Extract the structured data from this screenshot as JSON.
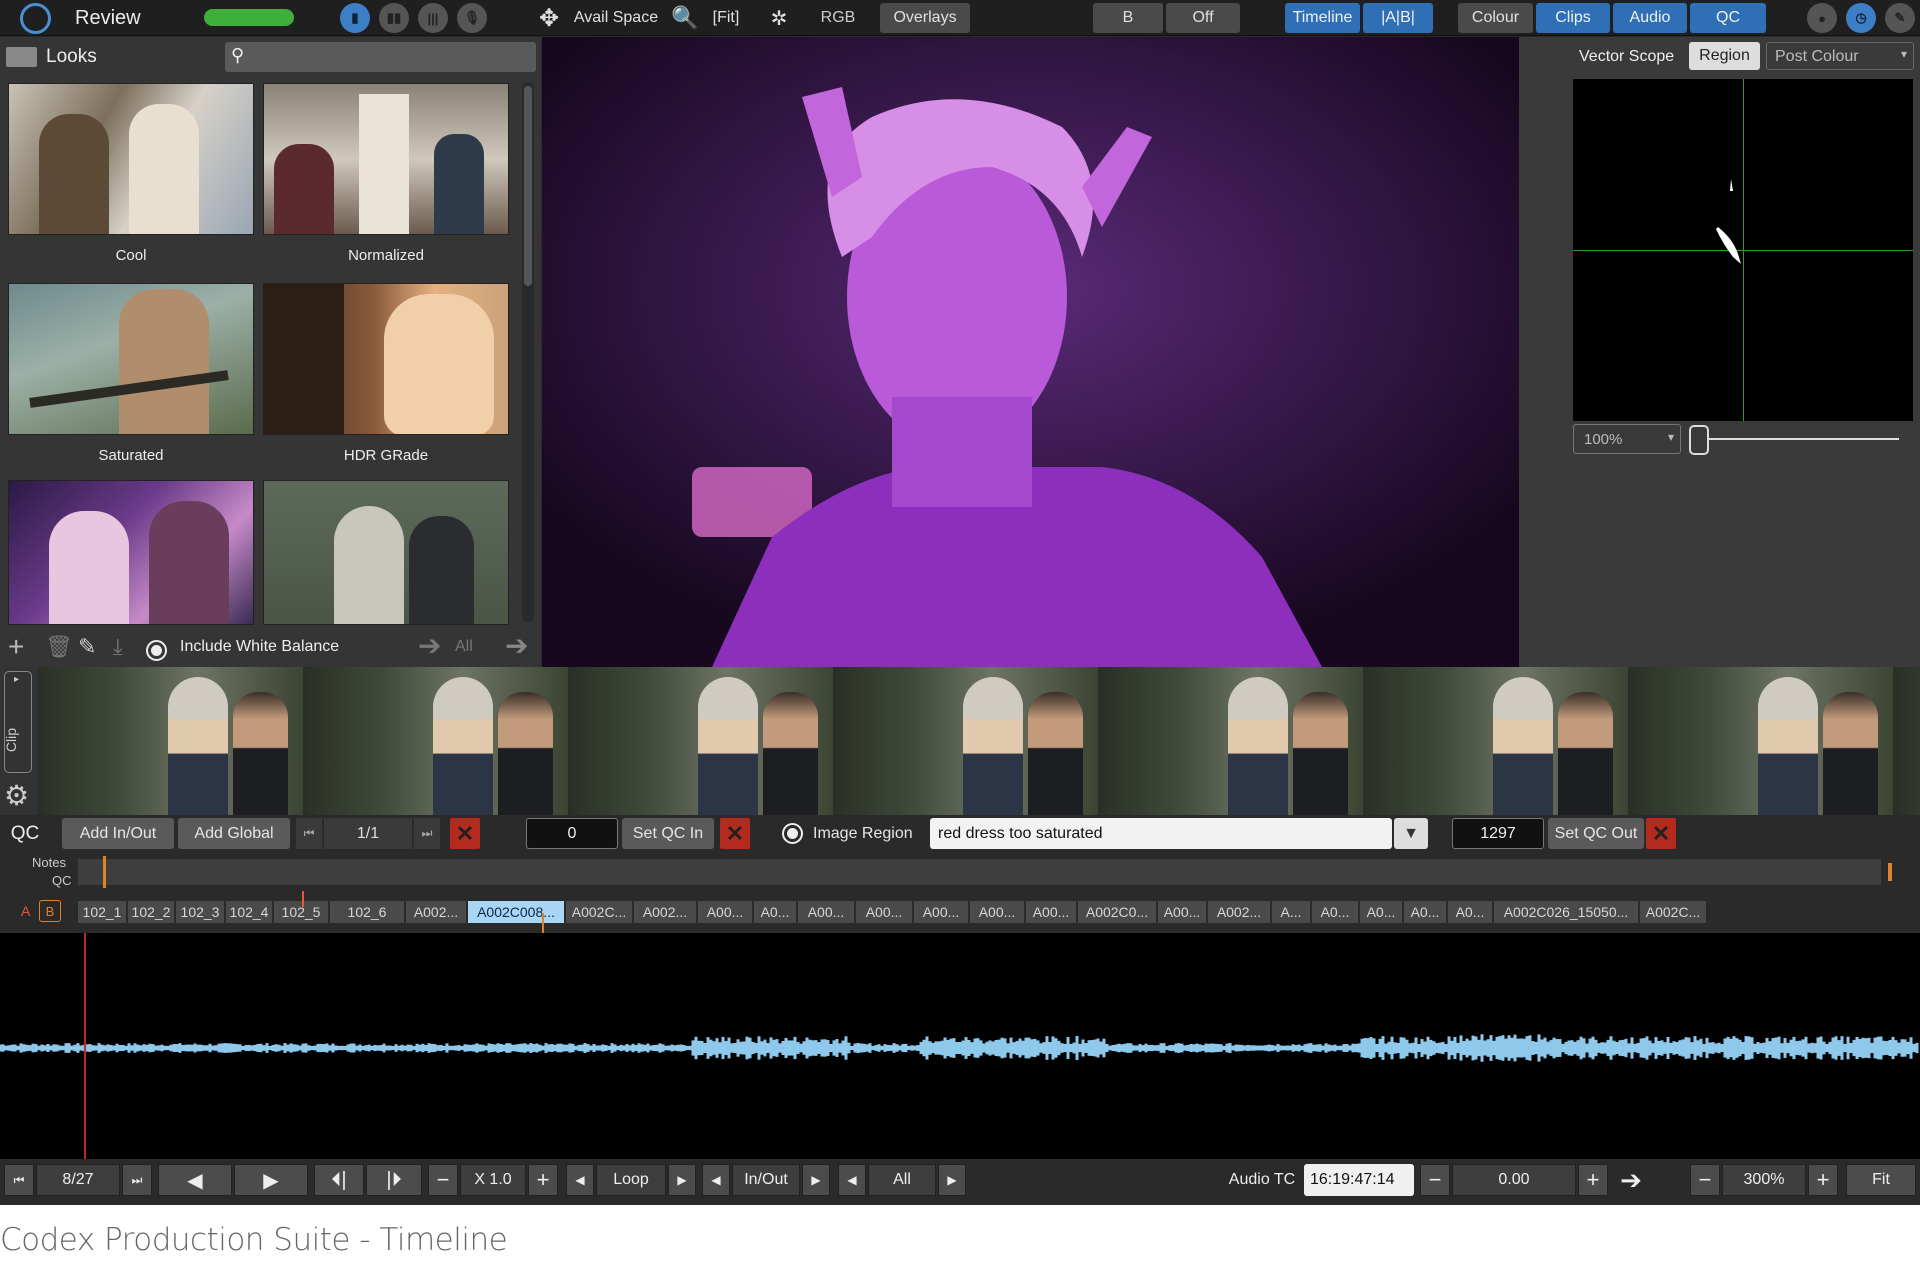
{
  "app": {
    "title": "Review",
    "caption": "Codex Production Suite  - Timeline"
  },
  "toolbar": {
    "avail_space": "Avail Space",
    "fit": "[Fit]",
    "rgb": "RGB",
    "overlays": "Overlays",
    "b": "B",
    "off": "Off",
    "timeline": "Timeline",
    "ab": "|A|B|",
    "colour": "Colour",
    "clips": "Clips",
    "audio": "Audio",
    "qc": "QC"
  },
  "looks": {
    "title": "Looks",
    "items": [
      {
        "label": "Cool"
      },
      {
        "label": "Normalized"
      },
      {
        "label": "Saturated"
      },
      {
        "label": "HDR GRade"
      },
      {
        "label": ""
      },
      {
        "label": ""
      }
    ],
    "include_white_balance": "Include White Balance",
    "all": "All"
  },
  "scope": {
    "title": "Vector Scope",
    "region": "Region",
    "mode": "Post Colour",
    "zoom": "100%",
    "slider_value": 0
  },
  "clipstrip": {
    "label": "Clip"
  },
  "qc": {
    "label": "QC",
    "add_in_out": "Add In/Out",
    "add_global": "Add Global",
    "page": "1/1",
    "in_value": "0",
    "set_qc_in": "Set QC In",
    "image_region": "Image Region",
    "note_text": "red dress too saturated",
    "out_value": "1297",
    "set_qc_out": "Set QC Out"
  },
  "tracks": {
    "notes_label": "Notes",
    "qc_label": "QC",
    "a_label": "A",
    "b_label": "B",
    "clips": [
      "102_1",
      "102_2",
      "102_3",
      "102_4",
      "102_5",
      "102_6",
      "A002...",
      "A002C008...",
      "A002C...",
      "A002...",
      "A00...",
      "A0...",
      "A00...",
      "A00...",
      "A00...",
      "A00...",
      "A00...",
      "A002C0...",
      "A00...",
      "A002...",
      "A...",
      "A0...",
      "A0...",
      "A0...",
      "A0...",
      "A002C026_15050...",
      "A002C..."
    ],
    "selected_index": 7
  },
  "transport": {
    "page": "8/27",
    "speed": "X 1.0",
    "loop": "Loop",
    "in_out": "In/Out",
    "all": "All",
    "audio_tc_label": "Audio TC",
    "audio_tc": "16:19:47:14",
    "offset": "0.00",
    "zoom": "300%",
    "fit": "Fit"
  },
  "colors": {
    "accent_blue": "#2f6fb5",
    "green_meter": "#3fae3a",
    "error_red": "#b52a1f",
    "selected_clip": "#a9d6f5",
    "waveform": "#8ec9ec"
  }
}
